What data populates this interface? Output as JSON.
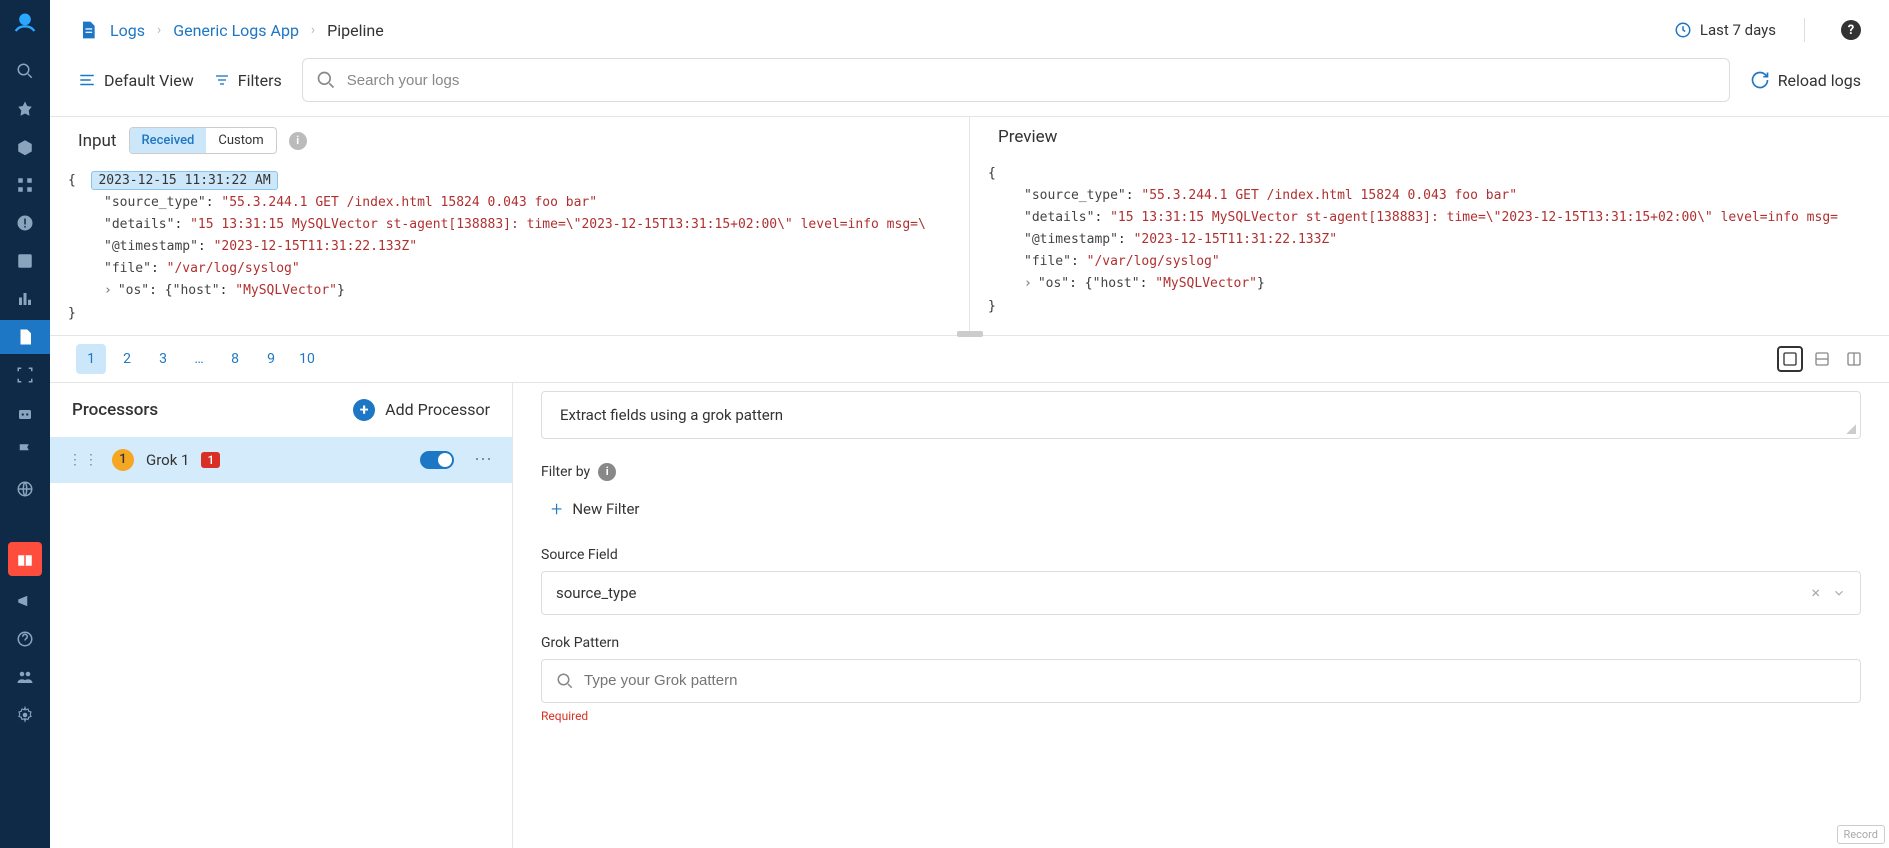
{
  "breadcrumb": {
    "l1": "Logs",
    "l2": "Generic Logs App",
    "l3": "Pipeline"
  },
  "timeRange": "Last 7 days",
  "toolbar": {
    "defaultView": "Default View",
    "filters": "Filters",
    "searchPlaceholder": "Search your logs",
    "reload": "Reload logs"
  },
  "inputPanel": {
    "title": "Input",
    "tabs": {
      "received": "Received",
      "custom": "Custom"
    },
    "timestampChip": "2023-12-15 11:31:22 AM",
    "fields": {
      "source_type": "\"55.3.244.1 GET /index.html 15824 0.043 foo bar\"",
      "details": "\"15 13:31:15 MySQLVector st-agent[138883]: time=\\\"2023-12-15T13:31:15+02:00\\\" level=info msg=\\",
      "@timestamp": "\"2023-12-15T11:31:22.133Z\"",
      "file": "\"/var/log/syslog\"",
      "osHost": "\"MySQLVector\""
    }
  },
  "previewPanel": {
    "title": "Preview",
    "fields": {
      "source_type": "\"55.3.244.1 GET /index.html 15824 0.043 foo bar\"",
      "details": "\"15 13:31:15 MySQLVector st-agent[138883]: time=\\\"2023-12-15T13:31:15+02:00\\\" level=info msg=",
      "@timestamp": "\"2023-12-15T11:31:22.133Z\"",
      "file": "\"/var/log/syslog\"",
      "osHost": "\"MySQLVector\""
    }
  },
  "pager": {
    "p1": "1",
    "p2": "2",
    "p3": "3",
    "dots": "…",
    "p8": "8",
    "p9": "9",
    "p10": "10"
  },
  "processors": {
    "title": "Processors",
    "add": "Add Processor",
    "item": {
      "num": "1",
      "name": "Grok 1",
      "err": "1"
    }
  },
  "config": {
    "description": "Extract fields using a grok pattern",
    "filterBy": "Filter by",
    "newFilter": "New Filter",
    "sourceFieldLabel": "Source Field",
    "sourceFieldValue": "source_type",
    "grokLabel": "Grok Pattern",
    "grokPlaceholder": "Type your Grok pattern",
    "required": "Required"
  },
  "record": "Record"
}
